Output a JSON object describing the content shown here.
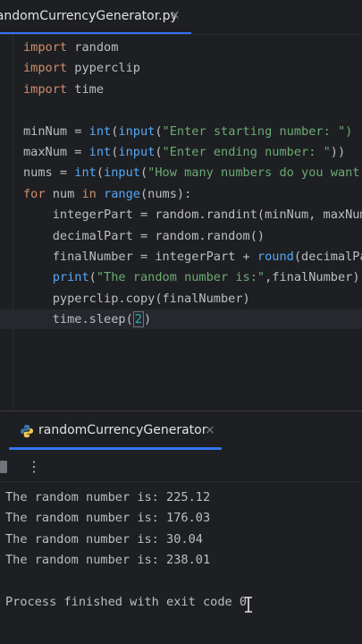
{
  "editor_tab": {
    "filename": "randomCurrencyGenerator.py",
    "close": "×"
  },
  "code": [
    [
      {
        "t": "import",
        "c": "kw"
      },
      {
        "t": " random",
        "c": "plain"
      }
    ],
    [
      {
        "t": "import",
        "c": "kw"
      },
      {
        "t": " pyperclip",
        "c": "plain"
      }
    ],
    [
      {
        "t": "import",
        "c": "kw"
      },
      {
        "t": " time",
        "c": "plain"
      }
    ],
    [],
    [
      {
        "t": "minNum = ",
        "c": "plain"
      },
      {
        "t": "int",
        "c": "fn"
      },
      {
        "t": "(",
        "c": "plain"
      },
      {
        "t": "input",
        "c": "fn"
      },
      {
        "t": "(",
        "c": "plain"
      },
      {
        "t": "\"Enter starting number: \")",
        "c": "str"
      }
    ],
    [
      {
        "t": "maxNum = ",
        "c": "plain"
      },
      {
        "t": "int",
        "c": "fn"
      },
      {
        "t": "(",
        "c": "plain"
      },
      {
        "t": "input",
        "c": "fn"
      },
      {
        "t": "(",
        "c": "plain"
      },
      {
        "t": "\"Enter ending number: \"",
        "c": "str"
      },
      {
        "t": "))",
        "c": "plain"
      }
    ],
    [
      {
        "t": "nums = ",
        "c": "plain"
      },
      {
        "t": "int",
        "c": "fn"
      },
      {
        "t": "(",
        "c": "plain"
      },
      {
        "t": "input",
        "c": "fn"
      },
      {
        "t": "(",
        "c": "plain"
      },
      {
        "t": "\"How many numbers do you want",
        "c": "str"
      }
    ],
    [
      {
        "t": "for",
        "c": "kw"
      },
      {
        "t": " num ",
        "c": "plain"
      },
      {
        "t": "in",
        "c": "kw"
      },
      {
        "t": " ",
        "c": "plain"
      },
      {
        "t": "range",
        "c": "fn"
      },
      {
        "t": "(nums):",
        "c": "plain"
      }
    ],
    [
      {
        "t": "    integerPart = random.randint(minNum, maxNum)",
        "c": "plain"
      }
    ],
    [
      {
        "t": "    decimalPart = random.random()",
        "c": "plain"
      }
    ],
    [
      {
        "t": "    finalNumber = integerPart + ",
        "c": "plain"
      },
      {
        "t": "round",
        "c": "fn"
      },
      {
        "t": "(decimalPart",
        "c": "plain"
      }
    ],
    [
      {
        "t": "    ",
        "c": "plain"
      },
      {
        "t": "print",
        "c": "fn"
      },
      {
        "t": "(",
        "c": "plain"
      },
      {
        "t": "\"The random number is:\"",
        "c": "str"
      },
      {
        "t": ",finalNumber)",
        "c": "plain"
      }
    ],
    [
      {
        "t": "    pyperclip.copy(finalNumber)",
        "c": "plain"
      }
    ],
    [
      {
        "t": "    time.sleep(",
        "c": "plain"
      },
      {
        "t": "2",
        "c": "num"
      },
      {
        "t": ")",
        "c": "plain"
      }
    ]
  ],
  "run_panel": {
    "tab_label": "randomCurrencyGenerator",
    "close": "×",
    "more_icon": "⋮",
    "output": [
      "The random number is: 225.12",
      "The random number is: 176.03",
      "The random number is: 30.04",
      "The random number is: 238.01",
      "",
      "Process finished with exit code 0"
    ]
  },
  "colors": {
    "accent": "#3574f0",
    "keyword": "#cf8e6d",
    "function": "#56a8f5",
    "string": "#6aab73",
    "number": "#2aacb8"
  }
}
